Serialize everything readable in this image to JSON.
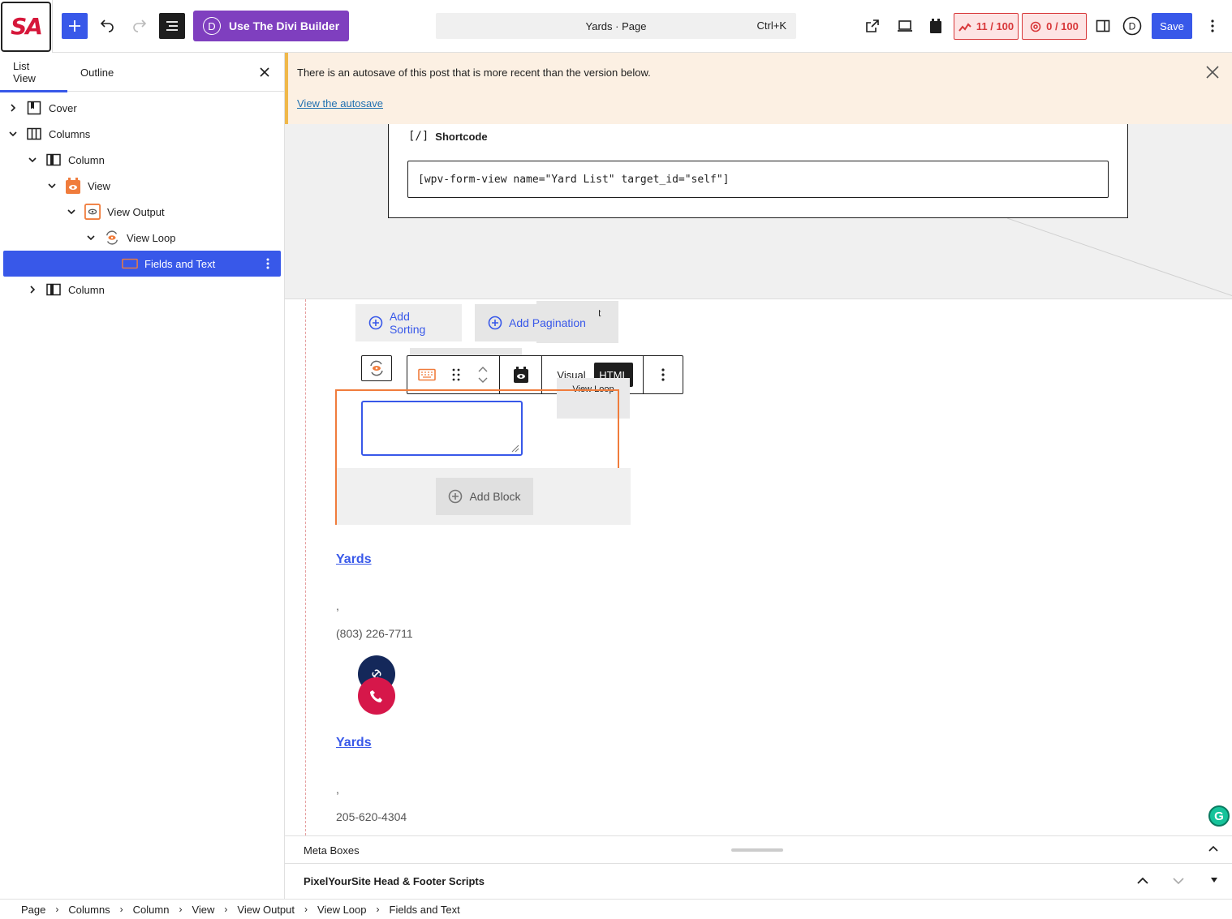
{
  "header": {
    "logo_text": "SA",
    "divi_button": "Use The Divi Builder",
    "divi_letter": "D",
    "command_title": "Yards · Page",
    "command_shortcut": "Ctrl+K",
    "badge_a": "11 / 100",
    "badge_b": "0 / 100",
    "save_label": "Save",
    "accent_color": "#3858e9"
  },
  "sidebar": {
    "tabs": [
      "List View",
      "Outline"
    ],
    "tree": [
      {
        "label": "Cover"
      },
      {
        "label": "Columns"
      },
      {
        "label": "Column"
      },
      {
        "label": "View"
      },
      {
        "label": "View Output"
      },
      {
        "label": "View Loop"
      },
      {
        "label": "Fields and Text"
      },
      {
        "label": "Column"
      }
    ]
  },
  "notice": {
    "text": "There is an autosave of this post that is more recent than the version below.",
    "link": "View the autosave"
  },
  "canvas": {
    "shortcode_label": "Shortcode",
    "shortcode_glyph": "[/]",
    "shortcode_value": "[wpv-form-view name=\"Yard List\" target_id=\"self\"]",
    "add_sorting": "Add Sorting",
    "add_pagination": "Add Pagination",
    "ghost_char": "t",
    "toolbar_visual": "Visual",
    "toolbar_html": "HTML",
    "tooltip": "View Loop",
    "add_block": "Add Block",
    "posts": [
      {
        "title": "Yards",
        "comma": ",",
        "phone": "(803) 226-7711"
      },
      {
        "title": "Yards",
        "comma": ",",
        "phone": "205-620-4304"
      }
    ],
    "grammarly_letter": "G"
  },
  "meta": {
    "meta_boxes": "Meta Boxes",
    "pixel_scripts": "PixelYourSite Head & Footer Scripts"
  },
  "breadcrumb": [
    "Page",
    "Columns",
    "Column",
    "View",
    "View Output",
    "View Loop",
    "Fields and Text"
  ]
}
